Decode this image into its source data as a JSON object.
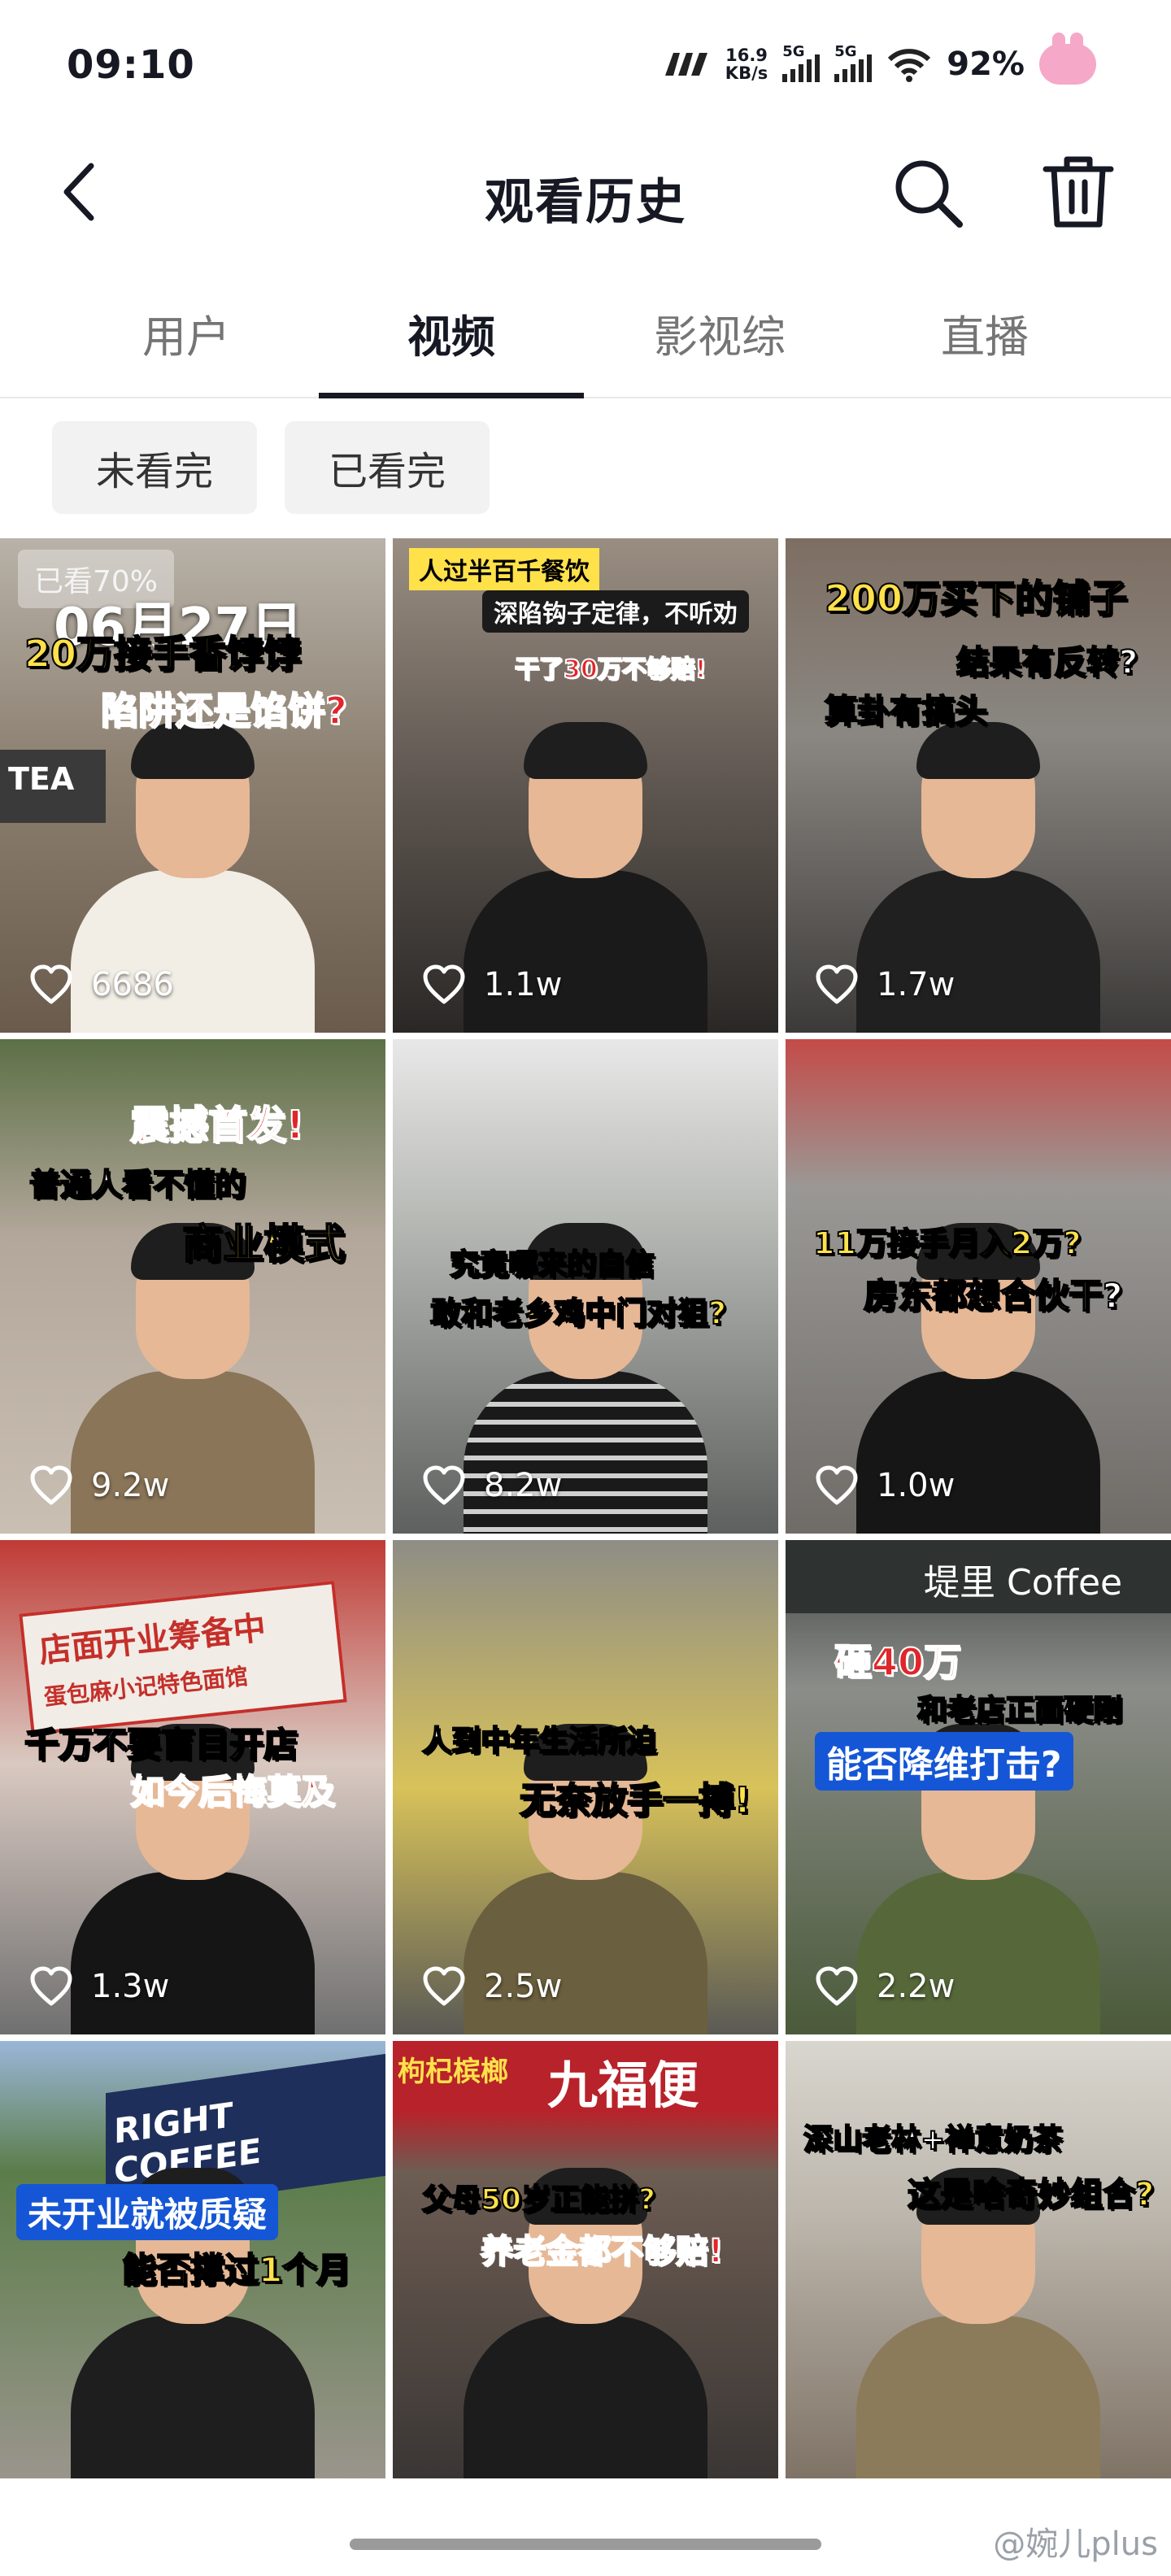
{
  "status_bar": {
    "time": "09:10",
    "network_speed_value": "16.9",
    "network_speed_unit": "KB/s",
    "sim1": "5G",
    "sim2": "5G",
    "battery": "92%",
    "icons": [
      "nfc-icon",
      "signal-icon",
      "signal-icon",
      "wifi-icon",
      "bunny-avatar-icon"
    ]
  },
  "header": {
    "title": "观看历史",
    "back_icon": "chevron-left-icon",
    "search_icon": "search-icon",
    "delete_icon": "trash-icon"
  },
  "tabs": [
    {
      "label": "用户",
      "active": false
    },
    {
      "label": "视频",
      "active": true
    },
    {
      "label": "影视综",
      "active": false
    },
    {
      "label": "直播",
      "active": false
    }
  ],
  "filters": [
    {
      "label": "未看完"
    },
    {
      "label": "已看完"
    }
  ],
  "date_header": "06月27日",
  "videos": [
    {
      "likes": "6686",
      "watched": "已看70%",
      "captions": [
        "20万接手香饽饽",
        "陷阱还是馅饼?",
        "TEA"
      ]
    },
    {
      "likes": "1.1w",
      "captions": [
        "人过半百千餐饮",
        "深陷钩子定律，不听劝",
        "干了30万不够赔!"
      ]
    },
    {
      "likes": "1.7w",
      "captions": [
        "200万买下的铺子",
        "结果有反转?",
        "算卦有搞头"
      ]
    },
    {
      "likes": "9.2w",
      "captions": [
        "震撼首发!",
        "普通人看不懂的",
        "商业模式"
      ]
    },
    {
      "likes": "8.2w",
      "captions": [
        "究竟哪来的自信",
        "敢和老乡鸡中门对狙?"
      ]
    },
    {
      "likes": "1.0w",
      "captions": [
        "11万接手月入2万?",
        "房东都想合伙干?"
      ]
    },
    {
      "likes": "1.3w",
      "captions": [
        "店面开业筹备中",
        "蛋包麻小记特色面馆",
        "千万不要盲目开店",
        "如今后悔莫及"
      ]
    },
    {
      "likes": "2.5w",
      "captions": [
        "人到中年生活所迫",
        "无奈放手一搏!"
      ]
    },
    {
      "likes": "2.2w",
      "captions": [
        "堤里 Coffee",
        "砸40万",
        "和老店正面硬刚",
        "能否降维打击?"
      ]
    },
    {
      "likes": "",
      "captions": [
        "RIGHT COFFEE",
        "未开业就被质疑",
        "能否撑过1个月"
      ]
    },
    {
      "likes": "",
      "captions": [
        "枸杞槟榔",
        "九福便",
        "父母50岁正能拼?",
        "养老金都不够赔!"
      ]
    },
    {
      "likes": "",
      "captions": [
        "深山老林+禅意奶茶",
        "这是啥奇妙组合?"
      ]
    }
  ],
  "watermark": "@婉儿plus",
  "colors": {
    "text_primary": "#161823",
    "text_secondary": "#757575",
    "caption_yellow": "#ffe14a",
    "caption_red": "#e0262a",
    "caption_blue": "#1456d6"
  }
}
